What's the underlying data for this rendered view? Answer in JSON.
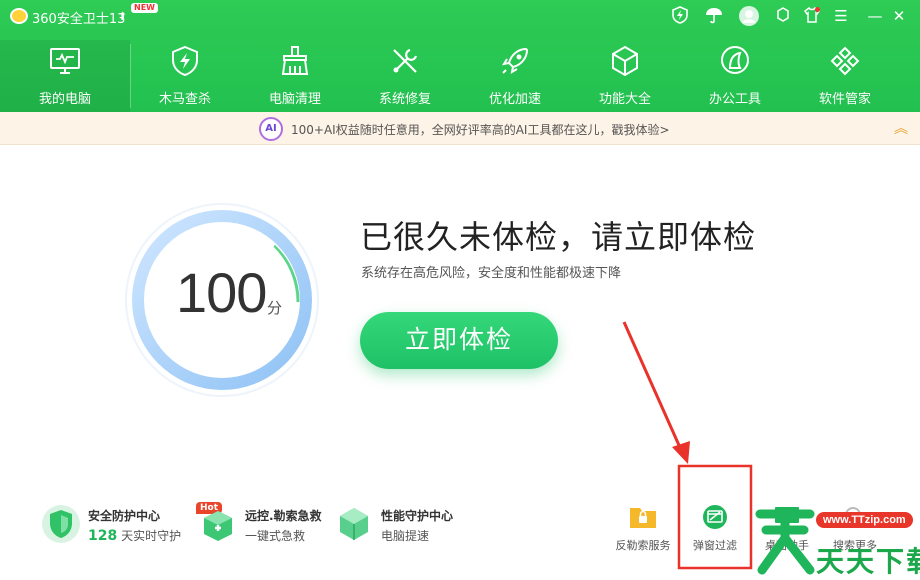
{
  "titlebar": {
    "app_title": "360安全卫士13",
    "new_badge": "NEW"
  },
  "nav": {
    "items": [
      {
        "label": "我的电脑"
      },
      {
        "label": "木马查杀"
      },
      {
        "label": "电脑清理"
      },
      {
        "label": "系统修复"
      },
      {
        "label": "优化加速"
      },
      {
        "label": "功能大全"
      },
      {
        "label": "办公工具"
      },
      {
        "label": "软件管家"
      }
    ]
  },
  "banner": {
    "ai_label": "AI",
    "text": "100+AI权益随时任意用，全网好评率高的AI工具都在这儿，戳我体验>"
  },
  "score": {
    "value": "100",
    "unit": "分"
  },
  "main": {
    "headline": "已很久未体检，请立即体检",
    "subline": "系统存在高危风险，安全度和性能都极速下降",
    "scan_button": "立即体检"
  },
  "features": [
    {
      "title": "安全防护中心",
      "num": "128",
      "sub": "天实时守护"
    },
    {
      "title": "远控.勒索急救",
      "sub": "一键式急救",
      "badge": "Hot"
    },
    {
      "title": "性能守护中心",
      "sub": "电脑提速"
    }
  ],
  "tools": [
    {
      "label": "反勒索服务"
    },
    {
      "label": "弹窗过滤"
    },
    {
      "label": "桌面助手"
    },
    {
      "label": "搜索更多"
    }
  ],
  "watermark": {
    "url": "www.TTzip.com",
    "text": "天天下载"
  },
  "colors": {
    "brand_green": "#22c04f",
    "button_green": "#1ec166",
    "annotation_red": "#e8322a"
  }
}
